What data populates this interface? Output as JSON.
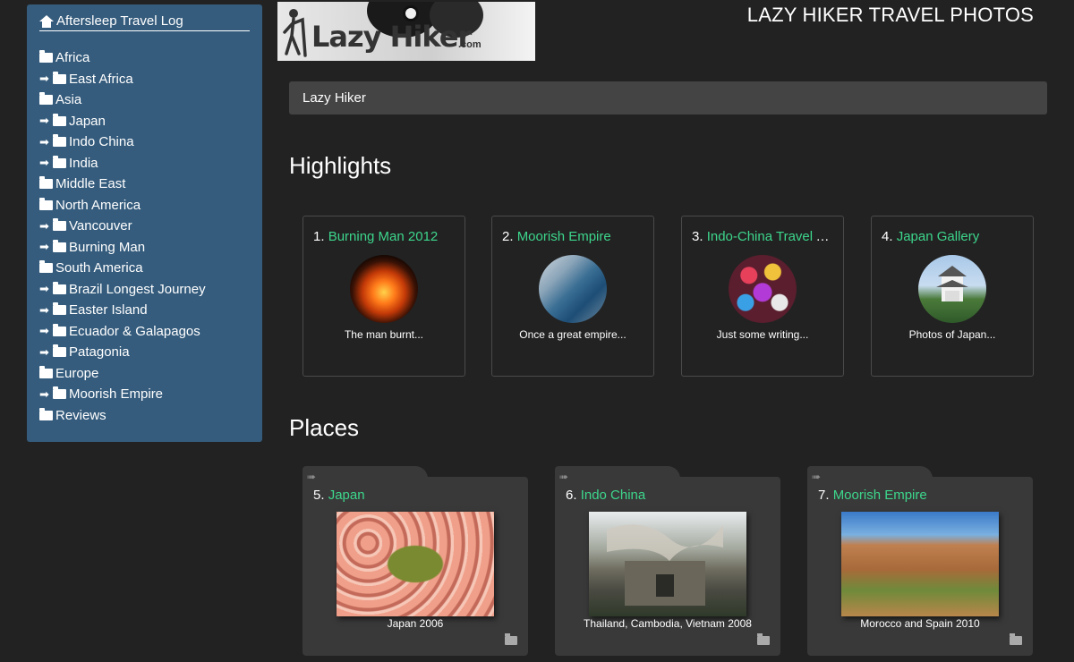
{
  "sidebar": {
    "title": "Aftersleep Travel Log",
    "items": [
      {
        "label": "Africa",
        "child": false
      },
      {
        "label": "East Africa",
        "child": true
      },
      {
        "label": "Asia",
        "child": false
      },
      {
        "label": "Japan",
        "child": true
      },
      {
        "label": "Indo China",
        "child": true
      },
      {
        "label": "India",
        "child": true
      },
      {
        "label": "Middle East",
        "child": false
      },
      {
        "label": "North America",
        "child": false
      },
      {
        "label": "Vancouver",
        "child": true
      },
      {
        "label": "Burning Man",
        "child": true
      },
      {
        "label": "South America",
        "child": false
      },
      {
        "label": "Brazil Longest Journey",
        "child": true
      },
      {
        "label": "Easter Island",
        "child": true
      },
      {
        "label": "Ecuador & Galapagos",
        "child": true
      },
      {
        "label": "Patagonia",
        "child": true
      },
      {
        "label": "Europe",
        "child": false
      },
      {
        "label": "Moorish Empire",
        "child": true
      },
      {
        "label": "Reviews",
        "child": false
      }
    ]
  },
  "logo": {
    "text": "Lazy Hiker",
    "suffix": ".com"
  },
  "header": {
    "title": "LAZY HIKER TRAVEL PHOTOS"
  },
  "breadcrumb": {
    "label": "Lazy Hiker"
  },
  "highlights": {
    "heading": "Highlights",
    "cards": [
      {
        "num": "1.",
        "title": "Burning Man 2012",
        "desc": "The man burnt..."
      },
      {
        "num": "2.",
        "title": "Moorish Empire",
        "desc": "Once a great empire..."
      },
      {
        "num": "3.",
        "title": "Indo-China Travel Advice",
        "desc": "Just some writing..."
      },
      {
        "num": "4.",
        "title": "Japan Gallery",
        "desc": "Photos of Japan..."
      }
    ]
  },
  "places": {
    "heading": "Places",
    "cards": [
      {
        "num": "5.",
        "title": "Japan",
        "caption": "Japan 2006"
      },
      {
        "num": "6.",
        "title": "Indo China",
        "caption": "Thailand, Cambodia, Vietnam 2008"
      },
      {
        "num": "7.",
        "title": "Moorish Empire",
        "caption": "Morocco and Spain 2010"
      }
    ]
  },
  "colors": {
    "sidebar": "#355c7d",
    "link": "#3dd68c",
    "background": "#222222"
  }
}
